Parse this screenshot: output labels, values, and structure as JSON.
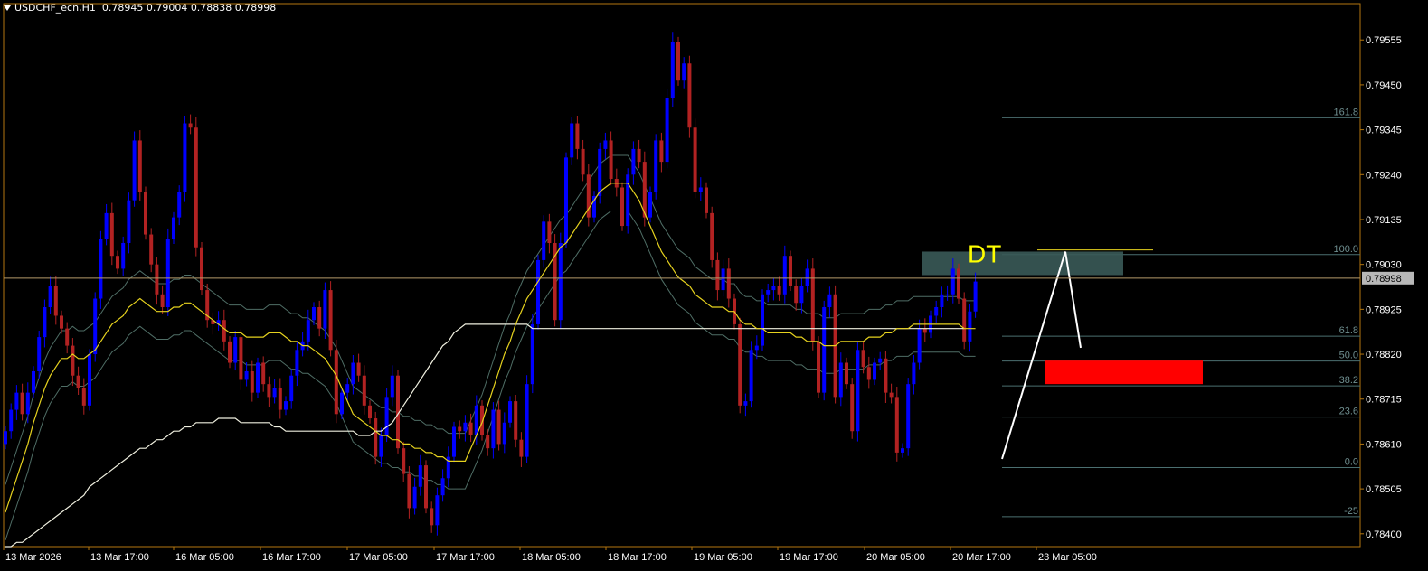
{
  "header": {
    "symbol": "USDCHF_ecn,H1",
    "ohlc": "0.78945 0.79004 0.78838 0.78998"
  },
  "colors": {
    "background": "#000000",
    "frame": "#b3760f",
    "bull": "#0000ff",
    "bear": "#b22222",
    "ema_fast": "#e6d21e",
    "ema_slow": "#f0f0e0",
    "band": "#4f6e66",
    "fib": "#4b6f70",
    "zone_top": "#3a5a58",
    "zone_bottom": "#ff0000",
    "price_line": "#b59a6a",
    "dt_label": "#ffff00",
    "current_price_bg": "#b8b8b8"
  },
  "chart_data": {
    "type": "candlestick",
    "y_axis": {
      "ticks": [
        "0.79555",
        "0.79450",
        "0.79345",
        "0.79240",
        "0.79135",
        "0.79030",
        "0.78925",
        "0.78820",
        "0.78715",
        "0.78610",
        "0.78505",
        "0.78400"
      ],
      "min": 0.7837,
      "max": 0.7964
    },
    "x_axis": {
      "ticks": [
        "13 Mar 2026",
        "13 Mar 17:00",
        "16 Mar 05:00",
        "16 Mar 17:00",
        "17 Mar 05:00",
        "17 Mar 17:00",
        "18 Mar 05:00",
        "18 Mar 17:00",
        "19 Mar 05:00",
        "19 Mar 17:00",
        "20 Mar 05:00",
        "20 Mar 17:00",
        "23 Mar 05:00"
      ]
    },
    "current_price": "0.78998",
    "closes": [
      0.7864,
      0.7869,
      0.7873,
      0.7868,
      0.7873,
      0.7878,
      0.7886,
      0.7893,
      0.7898,
      0.7891,
      0.7888,
      0.7884,
      0.7877,
      0.7874,
      0.787,
      0.7882,
      0.7895,
      0.7909,
      0.7915,
      0.7905,
      0.7902,
      0.7908,
      0.7918,
      0.7932,
      0.792,
      0.791,
      0.7903,
      0.7896,
      0.7893,
      0.7909,
      0.7914,
      0.792,
      0.7936,
      0.7935,
      0.7907,
      0.7897,
      0.789,
      0.7889,
      0.789,
      0.7885,
      0.788,
      0.7886,
      0.7876,
      0.7878,
      0.7873,
      0.788,
      0.7875,
      0.7872,
      0.7874,
      0.7869,
      0.7871,
      0.7877,
      0.7883,
      0.7885,
      0.789,
      0.7893,
      0.7888,
      0.7897,
      0.7883,
      0.7868,
      0.7873,
      0.7875,
      0.788,
      0.7877,
      0.787,
      0.7867,
      0.7858,
      0.7863,
      0.7872,
      0.7877,
      0.786,
      0.7854,
      0.7846,
      0.7851,
      0.7856,
      0.7846,
      0.7842,
      0.7849,
      0.7853,
      0.7858,
      0.7865,
      0.7864,
      0.7866,
      0.7863,
      0.787,
      0.7863,
      0.786,
      0.7869,
      0.7861,
      0.7866,
      0.7871,
      0.7862,
      0.7858,
      0.7875,
      0.7889,
      0.7904,
      0.7913,
      0.7908,
      0.789,
      0.7908,
      0.7928,
      0.7936,
      0.793,
      0.7924,
      0.7914,
      0.7919,
      0.793,
      0.7932,
      0.7923,
      0.7921,
      0.7912,
      0.7924,
      0.793,
      0.7927,
      0.7914,
      0.792,
      0.7932,
      0.7927,
      0.7942,
      0.7955,
      0.7946,
      0.795,
      0.7935,
      0.792,
      0.7921,
      0.7915,
      0.7904,
      0.7897,
      0.7902,
      0.7895,
      0.7889,
      0.787,
      0.7871,
      0.7883,
      0.7884,
      0.7896,
      0.7897,
      0.7898,
      0.7896,
      0.7905,
      0.7898,
      0.7894,
      0.7898,
      0.7902,
      0.7885,
      0.7873,
      0.7893,
      0.7896,
      0.7872,
      0.788,
      0.7875,
      0.7864,
      0.7883,
      0.7879,
      0.7876,
      0.788,
      0.7881,
      0.7873,
      0.7872,
      0.7859,
      0.786,
      0.7875,
      0.788,
      0.7888,
      0.7887,
      0.7891,
      0.7893,
      0.7896,
      0.7896,
      0.7902,
      0.7895,
      0.7885,
      0.7892,
      0.7899
    ],
    "ema_fast": [
      0.7845,
      0.7849,
      0.7853,
      0.7857,
      0.7861,
      0.7866,
      0.787,
      0.7874,
      0.7877,
      0.7879,
      0.7881,
      0.7881,
      0.7882,
      0.7881,
      0.7881,
      0.7882,
      0.7883,
      0.7885,
      0.7887,
      0.7889,
      0.789,
      0.7891,
      0.7893,
      0.7894,
      0.7895,
      0.7894,
      0.7893,
      0.7892,
      0.7892,
      0.7892,
      0.7893,
      0.7893,
      0.7894,
      0.7894,
      0.7893,
      0.7892,
      0.7891,
      0.789,
      0.7889,
      0.7888,
      0.7887,
      0.7887,
      0.7887,
      0.7886,
      0.7886,
      0.7886,
      0.7886,
      0.7887,
      0.7887,
      0.7887,
      0.7886,
      0.7885,
      0.7885,
      0.7884,
      0.7884,
      0.7883,
      0.7882,
      0.7881,
      0.7879,
      0.7877,
      0.7874,
      0.7871,
      0.7868,
      0.7867,
      0.7866,
      0.7865,
      0.7864,
      0.7863,
      0.7863,
      0.7862,
      0.7862,
      0.7861,
      0.7861,
      0.786,
      0.786,
      0.7859,
      0.7859,
      0.7858,
      0.7858,
      0.7857,
      0.7857,
      0.7857,
      0.7857,
      0.786,
      0.7863,
      0.7866,
      0.787,
      0.7874,
      0.7878,
      0.7882,
      0.7885,
      0.7889,
      0.7892,
      0.7895,
      0.7897,
      0.7899,
      0.7901,
      0.7903,
      0.7905,
      0.7907,
      0.7908,
      0.791,
      0.7912,
      0.7914,
      0.7916,
      0.7918,
      0.792,
      0.7921,
      0.7922,
      0.7922,
      0.7922,
      0.7922,
      0.792,
      0.7918,
      0.7915,
      0.7912,
      0.7909,
      0.7906,
      0.7904,
      0.7902,
      0.79,
      0.7899,
      0.7898,
      0.7896,
      0.7895,
      0.7894,
      0.7893,
      0.7893,
      0.7893,
      0.7892,
      0.7892,
      0.789,
      0.7889,
      0.7889,
      0.7888,
      0.7888,
      0.7887,
      0.7887,
      0.7887,
      0.7887,
      0.7887,
      0.7886,
      0.7886,
      0.7885,
      0.7885,
      0.7885,
      0.7884,
      0.7884,
      0.7884,
      0.7885,
      0.7885,
      0.7885,
      0.7885,
      0.7885,
      0.7886,
      0.7886,
      0.7886,
      0.7887,
      0.7887,
      0.7888,
      0.7888,
      0.7888,
      0.7889,
      0.7889,
      0.7889,
      0.7889,
      0.7889,
      0.7889,
      0.7889,
      0.7889,
      0.7889,
      0.7888,
      0.7888,
      0.7888
    ],
    "ema_slow": [
      0.7837,
      0.7837,
      0.7838,
      0.7838,
      0.7839,
      0.784,
      0.7841,
      0.7842,
      0.7843,
      0.7844,
      0.7845,
      0.7846,
      0.7847,
      0.7848,
      0.7849,
      0.7851,
      0.7852,
      0.7853,
      0.7854,
      0.7855,
      0.7856,
      0.7857,
      0.7858,
      0.7859,
      0.786,
      0.786,
      0.7861,
      0.7862,
      0.7862,
      0.7863,
      0.7864,
      0.7864,
      0.7865,
      0.7865,
      0.7866,
      0.7866,
      0.7866,
      0.7866,
      0.7867,
      0.7867,
      0.7867,
      0.7867,
      0.7866,
      0.7866,
      0.7866,
      0.7866,
      0.7866,
      0.7866,
      0.7865,
      0.7865,
      0.7864,
      0.7864,
      0.7864,
      0.7864,
      0.7864,
      0.7864,
      0.7864,
      0.7864,
      0.7864,
      0.7864,
      0.7864,
      0.7864,
      0.7864,
      0.7863,
      0.7863,
      0.7863,
      0.7864,
      0.7864,
      0.7865,
      0.7866,
      0.7868,
      0.787,
      0.7872,
      0.7874,
      0.7876,
      0.7878,
      0.788,
      0.7882,
      0.7884,
      0.7885,
      0.7887,
      0.7888,
      0.7889,
      0.7889,
      0.7889,
      0.7889,
      0.7889,
      0.7889,
      0.7889,
      0.7889,
      0.7889,
      0.7889,
      0.7889,
      0.7889,
      0.7888,
      0.7888,
      0.7888,
      0.7888,
      0.7888,
      0.7888,
      0.7888,
      0.7888,
      0.7888,
      0.7888,
      0.7888,
      0.7888,
      0.7888,
      0.7888,
      0.7888,
      0.7888,
      0.7888,
      0.7888,
      0.7888,
      0.7888,
      0.7888,
      0.7888,
      0.7888,
      0.7888,
      0.7888,
      0.7888,
      0.7888,
      0.7888,
      0.7888,
      0.7888,
      0.7888,
      0.7888,
      0.7888,
      0.7888,
      0.7888,
      0.7888,
      0.7888,
      0.7888,
      0.7888,
      0.7888,
      0.7888,
      0.7888,
      0.7888,
      0.7888,
      0.7888,
      0.7888,
      0.7888,
      0.7888,
      0.7888,
      0.7888,
      0.7888,
      0.7888,
      0.7888,
      0.7888,
      0.7888,
      0.7888,
      0.7888,
      0.7888,
      0.7888,
      0.7888,
      0.7888,
      0.7888,
      0.7888,
      0.7888,
      0.7888,
      0.7888,
      0.7888,
      0.7888,
      0.7888,
      0.7888,
      0.7888,
      0.7888,
      0.7888,
      0.7888,
      0.7888,
      0.7888,
      0.7888,
      0.7888
    ],
    "fib_levels": [
      {
        "label": "161.8",
        "price": 0.79373
      },
      {
        "label": "100.0",
        "price": 0.79053
      },
      {
        "label": "61.8",
        "price": 0.78862
      },
      {
        "label": "50.0",
        "price": 0.78804
      },
      {
        "label": "38.2",
        "price": 0.78746
      },
      {
        "label": "23.6",
        "price": 0.78673
      },
      {
        "label": "0.0",
        "price": 0.78555
      },
      {
        "label": "-25",
        "price": 0.7844
      }
    ],
    "zones": [
      {
        "price_top": 0.7906,
        "price_bottom": 0.79005
      },
      {
        "price_top": 0.78805,
        "price_bottom": 0.7875
      }
    ],
    "annotations": [
      {
        "text": "DT"
      }
    ],
    "pattern": [
      {
        "price": 0.78575
      },
      {
        "price": 0.7906
      },
      {
        "price": 0.78835
      }
    ]
  }
}
